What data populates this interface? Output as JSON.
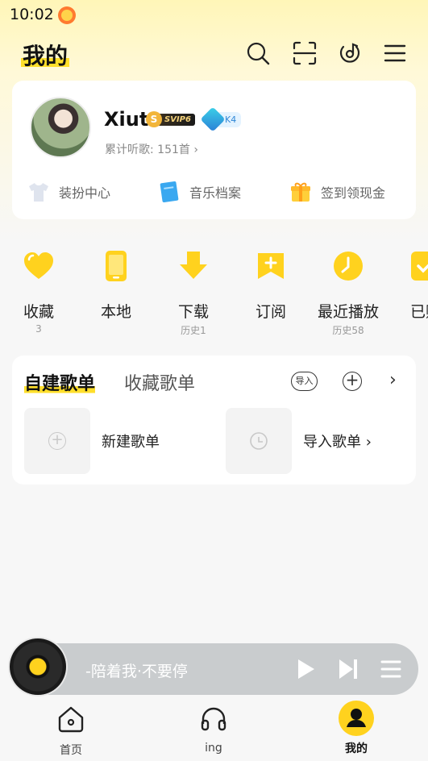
{
  "status_bar": {
    "time": "10:02"
  },
  "header": {
    "title": "我的"
  },
  "profile": {
    "username": "Xiut",
    "vip_tier": "S",
    "vip_label": "SVIP6",
    "level_label": "K4",
    "listen_count": "累计听歌: 151首 ›",
    "links": [
      {
        "label": "装扮中心",
        "icon": "shirt-icon"
      },
      {
        "label": "音乐档案",
        "icon": "music-book-icon"
      },
      {
        "label": "签到领现金",
        "icon": "gift-icon"
      }
    ]
  },
  "shortcuts": [
    {
      "label": "收藏",
      "sub": "3",
      "icon": "heart-icon"
    },
    {
      "label": "本地",
      "sub": "",
      "icon": "phone-icon"
    },
    {
      "label": "下载",
      "sub": "历史1",
      "icon": "download-icon"
    },
    {
      "label": "订阅",
      "sub": "",
      "icon": "subscribe-icon"
    },
    {
      "label": "最近播放",
      "sub": "历史58",
      "icon": "clock-icon"
    },
    {
      "label": "已购",
      "sub": "",
      "icon": "purchased-icon"
    }
  ],
  "playlists": {
    "tab_own": "自建歌单",
    "tab_fav": "收藏歌单",
    "import_badge": "导入",
    "add_symbol": "+",
    "more_symbol": "›",
    "new_playlist": "新建歌单",
    "import_playlist": "导入歌单 ›"
  },
  "player": {
    "now_playing": "-陪着我·不要停"
  },
  "tabbar": [
    {
      "label": "首页",
      "icon": "home-icon",
      "active": false
    },
    {
      "label": "ing",
      "icon": "headphones-icon",
      "active": false
    },
    {
      "label": "我的",
      "icon": "profile-icon",
      "active": true
    }
  ],
  "colors": {
    "accent": "#ffd21e",
    "background": "#f7f7f7"
  }
}
